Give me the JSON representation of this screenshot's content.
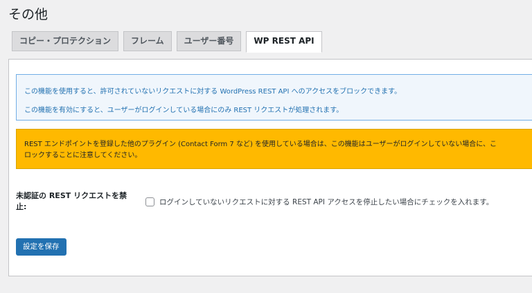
{
  "page": {
    "title": "その他"
  },
  "tabs": [
    {
      "label": "コピー・プロテクション",
      "active": false
    },
    {
      "label": "フレーム",
      "active": false
    },
    {
      "label": "ユーザー番号",
      "active": false
    },
    {
      "label": "WP REST API",
      "active": true
    }
  ],
  "notice_info": {
    "line1": "この機能を使用すると、許可されていないリクエストに対する WordPress REST API へのアクセスをブロックできます。",
    "line2": "この機能を有効にすると、ユーザーがログインしている場合にのみ REST リクエストが処理されます。"
  },
  "notice_warning": {
    "line1": "REST エンドポイントを登録した他のプラグイン (Contact Form 7 など) を使用している場合は、この機能はユーザーがログインしていない場合に、こ",
    "line2": "ロックすることに注意してください。"
  },
  "form": {
    "label_line1": "未認証の REST リクエストを禁",
    "label_line2": "止:",
    "checkbox_label": "ログインしていないリクエストに対する REST API アクセスを停止したい場合にチェックを入れます。",
    "checkbox_checked": false
  },
  "save_button": {
    "label": "設定を保存"
  },
  "colors": {
    "background": "#f0f0f1",
    "info_border": "#72aee6",
    "info_text": "#2271b1",
    "warning_background": "#ffb900",
    "button_primary": "#2271b1"
  }
}
